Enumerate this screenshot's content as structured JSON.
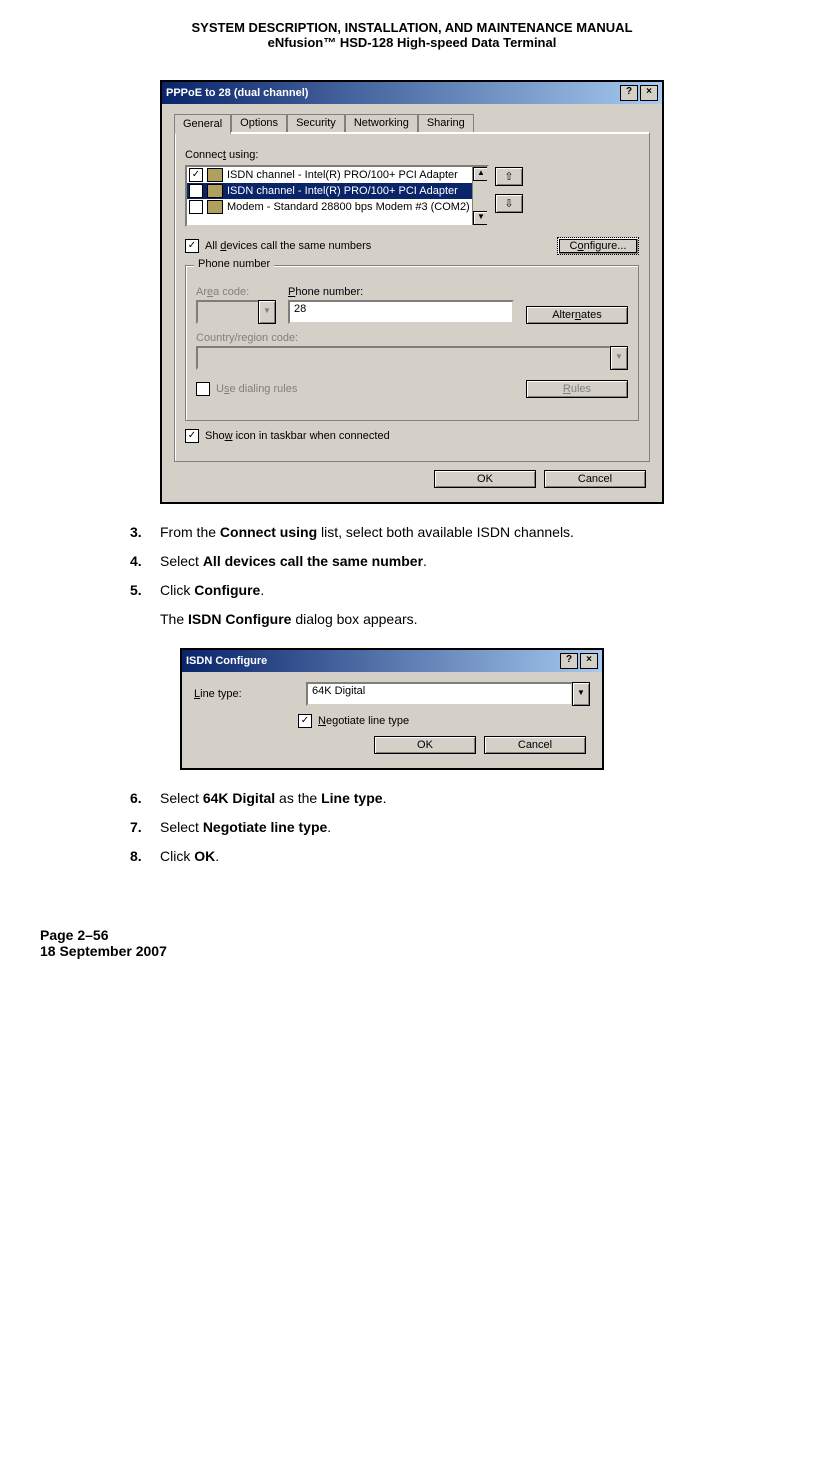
{
  "header": {
    "title": "SYSTEM DESCRIPTION, INSTALLATION, AND MAINTENANCE MANUAL",
    "subtitle": "eNfusion™ HSD-128 High-speed Data Terminal"
  },
  "dialog1": {
    "title": "PPPoE to 28 (dual channel)",
    "tabs": [
      "General",
      "Options",
      "Security",
      "Networking",
      "Sharing"
    ],
    "connect_using_label": "Connect using:",
    "devices": [
      {
        "checked": "✓",
        "text": "ISDN  channel - Intel(R) PRO/100+ PCI Adapter",
        "selected": false
      },
      {
        "checked": "✓",
        "text": "ISDN  channel - Intel(R) PRO/100+ PCI Adapter",
        "selected": true
      },
      {
        "checked": "",
        "text": "Modem - Standard 28800 bps Modem #3 (COM2)",
        "selected": false
      }
    ],
    "all_devices_label": "All devices call the same numbers",
    "configure_btn": "Configure...",
    "phone_group": "Phone number",
    "area_code_label": "Area code:",
    "phone_number_label": "Phone number:",
    "phone_number_value": "28",
    "alternates_btn": "Alternates",
    "country_label": "Country/region code:",
    "use_dialing_label": "Use dialing rules",
    "rules_btn": "Rules",
    "show_icon_label": "Show icon in taskbar when connected",
    "ok_btn": "OK",
    "cancel_btn": "Cancel"
  },
  "steps_a": [
    {
      "num": "3.",
      "pre": "From the ",
      "b1": "Connect using",
      "post": " list, select both available ISDN channels."
    },
    {
      "num": "4.",
      "pre": "Select ",
      "b1": "All devices call the same number",
      "post": "."
    },
    {
      "num": "5.",
      "pre": "Click ",
      "b1": "Configure",
      "post": "."
    }
  ],
  "para1": {
    "pre": "The ",
    "b1": "ISDN Configure",
    "post": " dialog box appears."
  },
  "dialog2": {
    "title": "ISDN Configure",
    "line_type_label": "Line type:",
    "line_type_value": "64K Digital",
    "negotiate_label": "Negotiate line type",
    "ok_btn": "OK",
    "cancel_btn": "Cancel"
  },
  "steps_b": [
    {
      "num": "6.",
      "pre": "Select ",
      "b1": "64K Digital",
      "mid": " as the ",
      "b2": "Line type",
      "post": "."
    },
    {
      "num": "7.",
      "pre": "Select ",
      "b1": "Negotiate line type",
      "post": "."
    },
    {
      "num": "8.",
      "pre": "Click ",
      "b1": "OK",
      "post": "."
    }
  ],
  "footer": {
    "page": "Page 2–56",
    "date": "18 September 2007"
  }
}
